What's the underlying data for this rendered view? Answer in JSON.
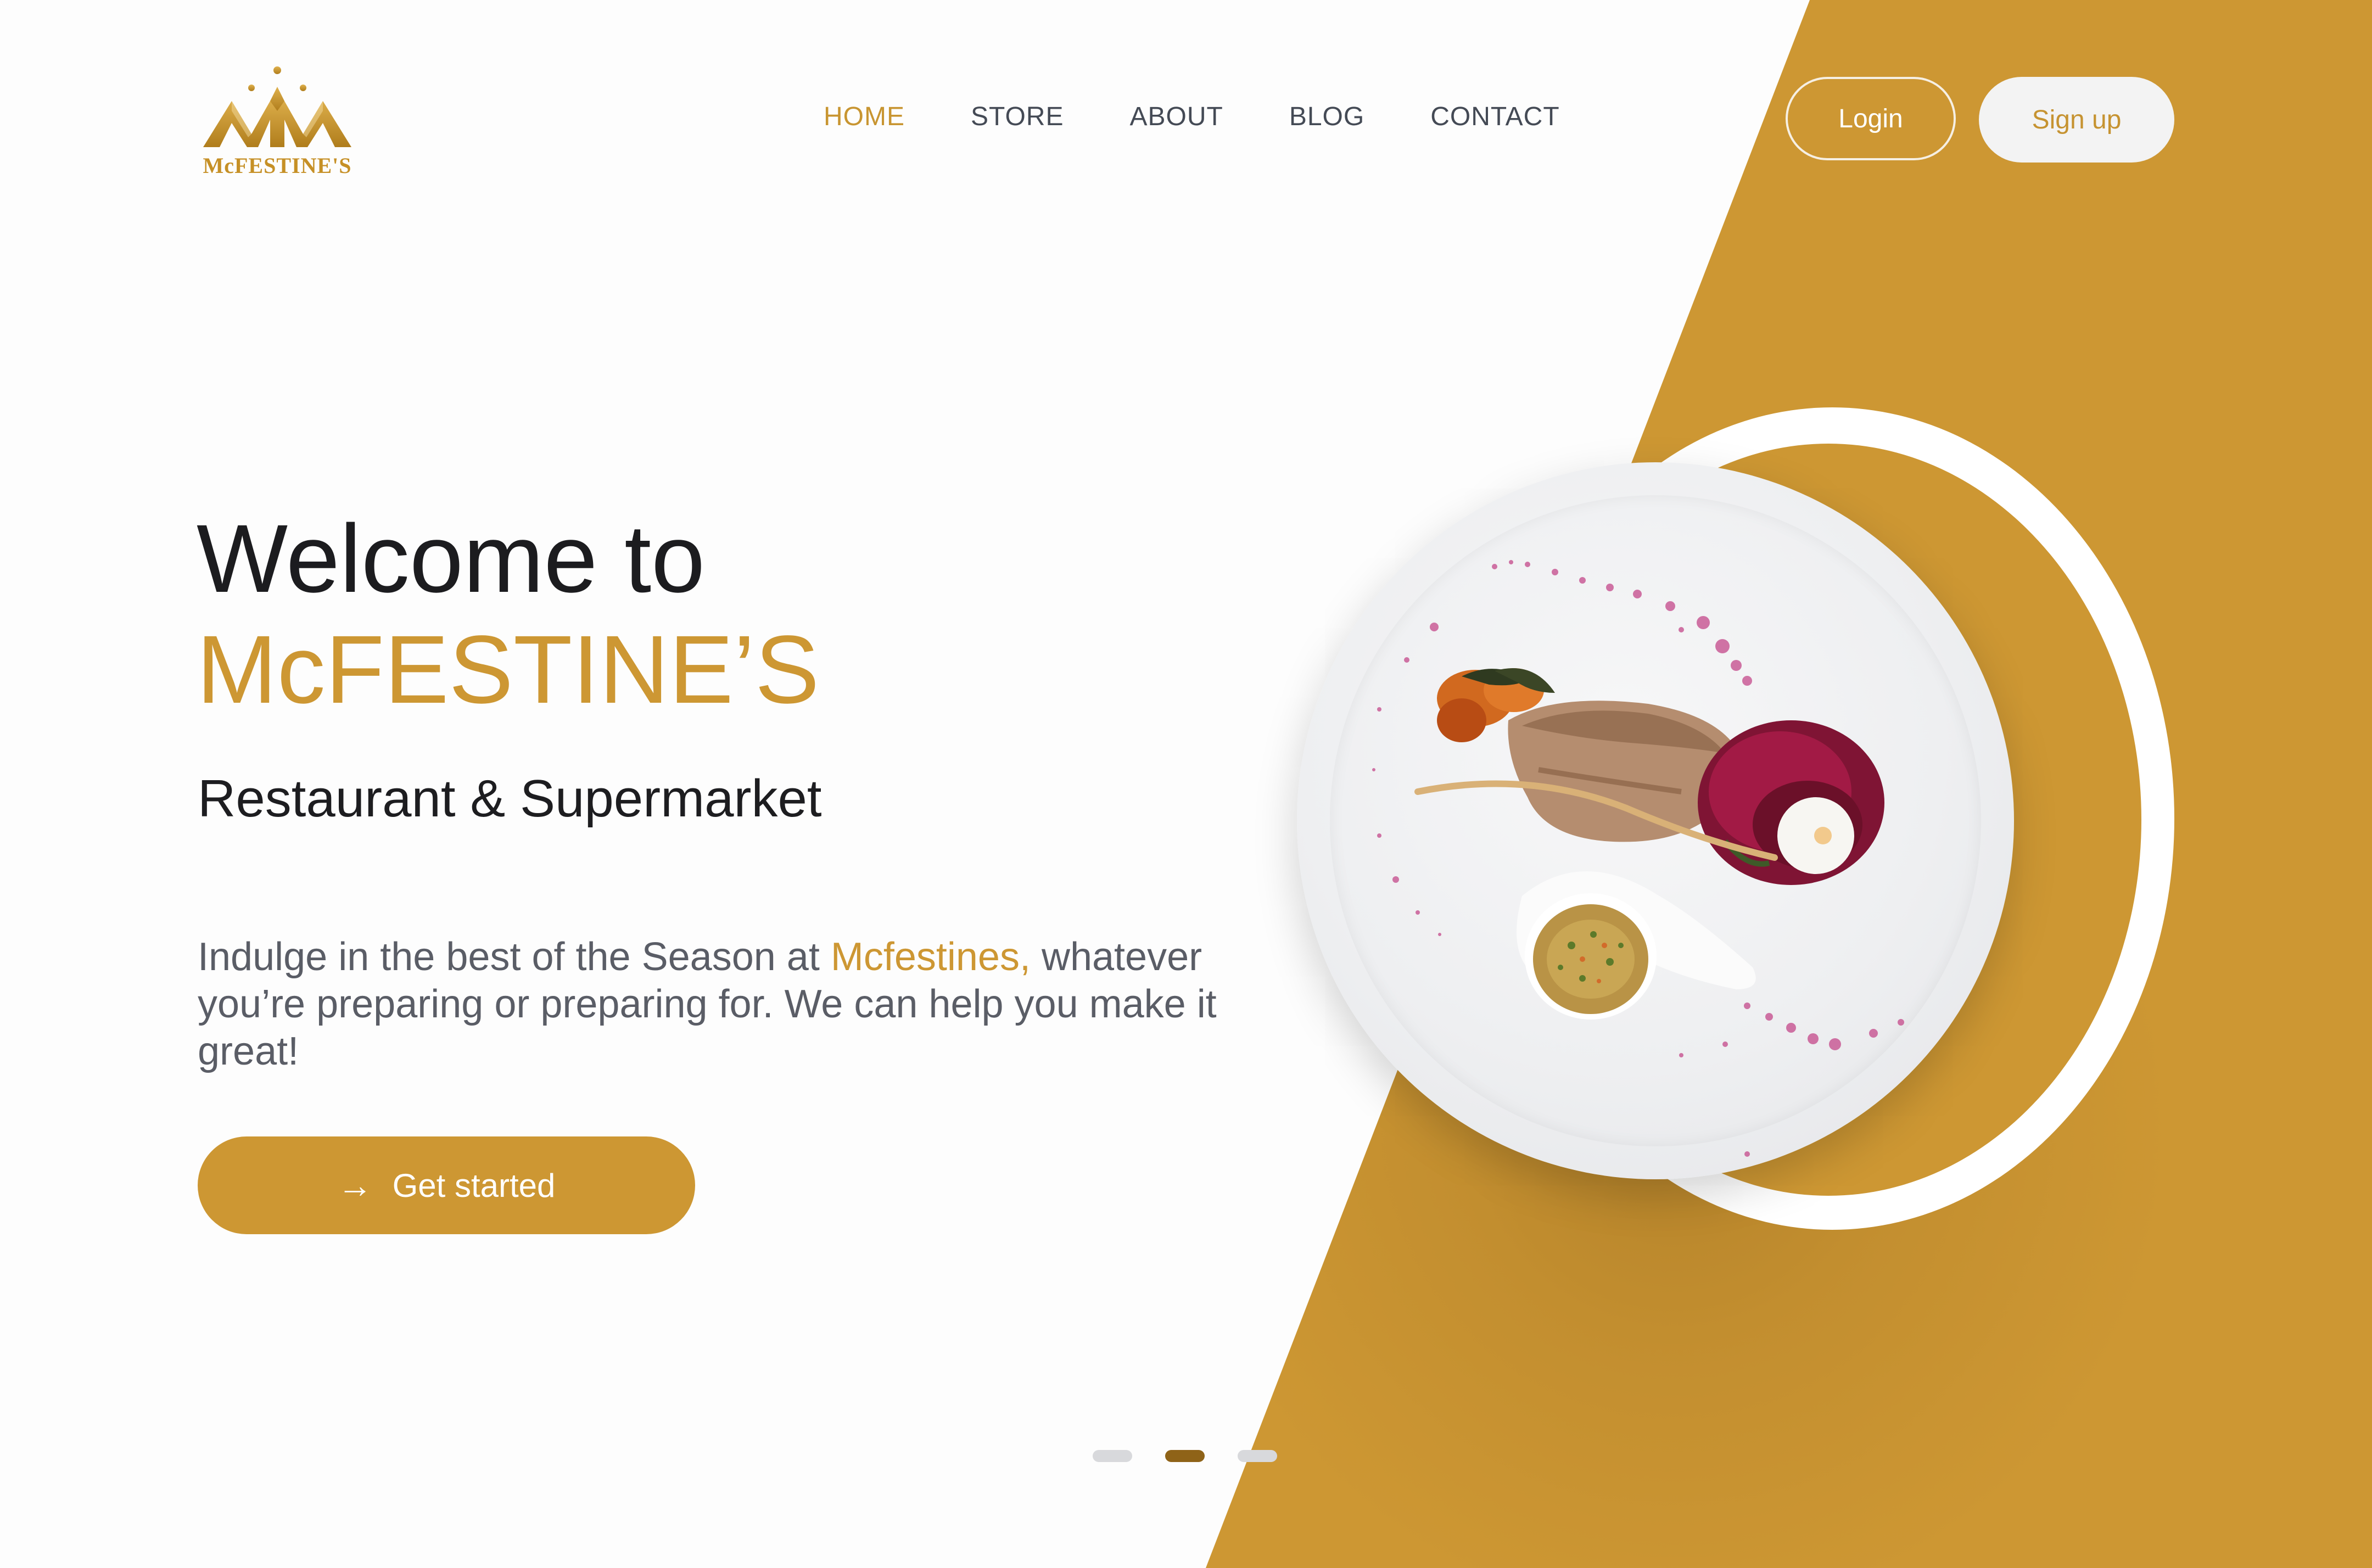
{
  "brand": {
    "logo_text": "McFESTINE'S",
    "logo_icon": "crown-logo-icon"
  },
  "nav": {
    "items": [
      {
        "label": "HOME",
        "active": true
      },
      {
        "label": "STORE",
        "active": false
      },
      {
        "label": "ABOUT",
        "active": false
      },
      {
        "label": "BLOG",
        "active": false
      },
      {
        "label": "CONTACT",
        "active": false
      }
    ],
    "login_label": "Login",
    "signup_label": "Sign up"
  },
  "hero": {
    "title": "Welcome to",
    "brand_name": "McFESTINE’S",
    "subtitle": "Restaurant & Supermarket",
    "desc_before": "Indulge in the best of the Season at ",
    "desc_accent": "Mcfestines,",
    "desc_after": " whatever you’re preparing or preparing for. We can help you make it great!",
    "cta_label": "Get started",
    "cta_icon": "arrow-right-icon"
  },
  "hero_image": {
    "subject": "plated dish icon"
  },
  "carousel": {
    "slides": 3,
    "active_index": 1
  },
  "colors": {
    "accent": "#cd9733",
    "dark_accent": "#8f6318",
    "text_dark": "#1c1c1f",
    "text_muted": "#5a5d66",
    "background": "#fdfdfd"
  }
}
